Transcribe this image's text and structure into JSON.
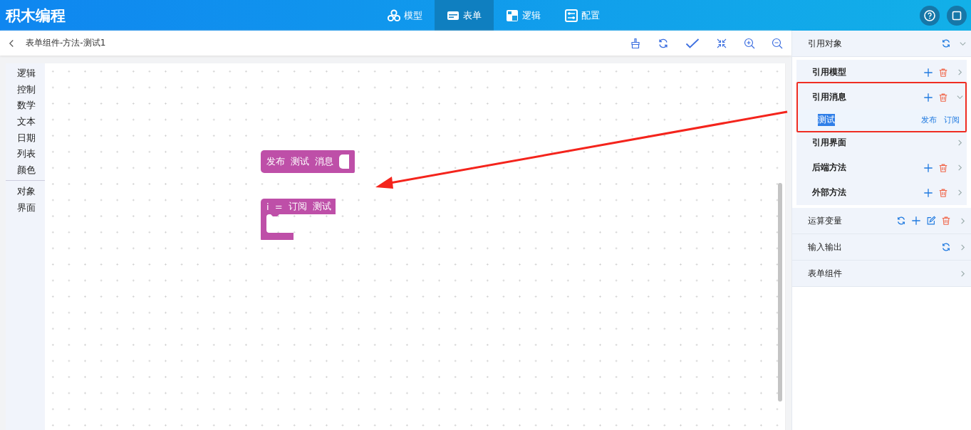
{
  "app_title": "积木编程",
  "nav_tabs": [
    {
      "label": "模型",
      "selected": false
    },
    {
      "label": "表单",
      "selected": true
    },
    {
      "label": "逻辑",
      "selected": false
    },
    {
      "label": "配置",
      "selected": false
    }
  ],
  "breadcrumb": "表单组件-方法-测试1",
  "toolbox": [
    [
      "逻辑",
      "控制",
      "数学",
      "文本",
      "日期",
      "列表",
      "颜色"
    ],
    [
      "对象",
      "界面"
    ]
  ],
  "blocks": [
    {
      "kind": "statement",
      "words": [
        "发布",
        "测试",
        "消息"
      ]
    },
    {
      "kind": "c-shape",
      "words": [
        "i",
        "=",
        "订阅",
        "测试"
      ]
    }
  ],
  "panel": [
    {
      "title": "引用对象",
      "actions": [
        {
          "kind": "refresh"
        }
      ],
      "expanded": true,
      "children": [
        {
          "title": "引用模型",
          "actions": [
            {
              "kind": "add"
            },
            {
              "kind": "delete"
            }
          ],
          "expanded": false,
          "highlighted": false
        },
        {
          "title": "引用消息",
          "actions": [
            {
              "kind": "add"
            },
            {
              "kind": "delete"
            }
          ],
          "expanded": true,
          "highlighted": true,
          "items": [
            {
              "name": "测试",
              "selected": true,
              "links": [
                "发布",
                "订阅"
              ]
            }
          ]
        },
        {
          "title": "引用界面",
          "expanded": false,
          "highlighted": false
        },
        {
          "title": "后端方法",
          "actions": [
            {
              "kind": "add"
            },
            {
              "kind": "delete"
            }
          ],
          "expanded": false,
          "highlighted": false
        },
        {
          "title": "外部方法",
          "actions": [
            {
              "kind": "add"
            },
            {
              "kind": "delete"
            }
          ],
          "expanded": false,
          "highlighted": false
        }
      ]
    },
    {
      "title": "运算变量",
      "actions": [
        {
          "kind": "refresh"
        },
        {
          "kind": "add"
        },
        {
          "kind": "edit"
        },
        {
          "kind": "delete"
        }
      ],
      "expanded": false
    },
    {
      "title": "输入输出",
      "actions": [
        {
          "kind": "refresh"
        }
      ],
      "expanded": false
    },
    {
      "title": "表单组件",
      "expanded": false
    }
  ]
}
